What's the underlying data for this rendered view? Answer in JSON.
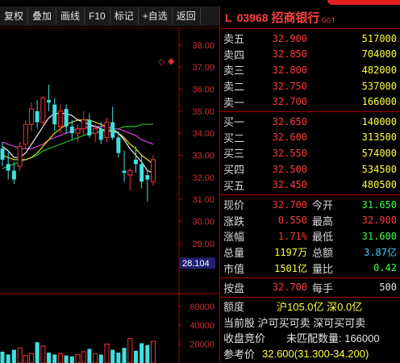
{
  "toolbar": {
    "buttons": [
      "复权",
      "叠加",
      "画线",
      "F10",
      "标记",
      "+自选",
      "返回"
    ]
  },
  "chart": {
    "price_ticks": [
      "38.00",
      "37.00",
      "36.00",
      "35.00",
      "34.00",
      "33.00",
      "32.00",
      "31.00",
      "30.00",
      "29.00",
      "28.00"
    ],
    "current_price_label": "28.104",
    "volume_ticks": [
      "60000",
      "40000",
      "20000"
    ]
  },
  "chart_data": {
    "type": "candlestick",
    "ylim": [
      27.6,
      38.8
    ],
    "candles": [
      {
        "o": 33.3,
        "h": 33.6,
        "l": 32.5,
        "c": 32.8
      },
      {
        "o": 32.6,
        "h": 33.2,
        "l": 31.9,
        "c": 32.3
      },
      {
        "o": 32.3,
        "h": 32.7,
        "l": 31.7,
        "c": 31.9
      },
      {
        "o": 32.5,
        "h": 33.6,
        "l": 32.3,
        "c": 33.4
      },
      {
        "o": 33.5,
        "h": 34.6,
        "l": 33.3,
        "c": 34.4
      },
      {
        "o": 34.4,
        "h": 35.4,
        "l": 34.1,
        "c": 35.1
      },
      {
        "o": 35.0,
        "h": 35.5,
        "l": 34.2,
        "c": 34.5
      },
      {
        "o": 34.5,
        "h": 35.7,
        "l": 34.3,
        "c": 35.6
      },
      {
        "o": 35.5,
        "h": 36.2,
        "l": 35.0,
        "c": 35.4
      },
      {
        "o": 35.3,
        "h": 35.6,
        "l": 34.1,
        "c": 34.4
      },
      {
        "o": 34.3,
        "h": 35.3,
        "l": 34.0,
        "c": 35.0
      },
      {
        "o": 35.1,
        "h": 35.3,
        "l": 34.0,
        "c": 34.3
      },
      {
        "o": 34.3,
        "h": 34.6,
        "l": 33.7,
        "c": 34.0
      },
      {
        "o": 34.0,
        "h": 34.4,
        "l": 33.6,
        "c": 34.2
      },
      {
        "o": 34.2,
        "h": 35.0,
        "l": 33.9,
        "c": 34.6
      },
      {
        "o": 34.6,
        "h": 34.9,
        "l": 33.8,
        "c": 33.9
      },
      {
        "o": 34.0,
        "h": 34.4,
        "l": 33.6,
        "c": 34.2
      },
      {
        "o": 34.2,
        "h": 34.5,
        "l": 33.5,
        "c": 33.7
      },
      {
        "o": 33.8,
        "h": 34.7,
        "l": 33.6,
        "c": 34.5
      },
      {
        "o": 34.5,
        "h": 35.2,
        "l": 33.7,
        "c": 33.8
      },
      {
        "o": 33.8,
        "h": 34.1,
        "l": 32.9,
        "c": 33.1
      },
      {
        "o": 32.3,
        "h": 33.2,
        "l": 31.8,
        "c": 32.2
      },
      {
        "o": 32.1,
        "h": 32.4,
        "l": 31.4,
        "c": 32.3
      },
      {
        "o": 32.8,
        "h": 33.4,
        "l": 32.2,
        "c": 32.6
      },
      {
        "o": 32.6,
        "h": 33.0,
        "l": 31.5,
        "c": 31.8
      },
      {
        "o": 32.1,
        "h": 32.3,
        "l": 30.9,
        "c": 31.9
      },
      {
        "o": 31.8,
        "h": 33.0,
        "l": 31.6,
        "c": 32.8
      }
    ],
    "ma_white": [
      33.4,
      33.2,
      32.9,
      32.9,
      33.1,
      33.5,
      33.9,
      34.3,
      34.7,
      34.9,
      34.9,
      34.9,
      34.8,
      34.6,
      34.5,
      34.4,
      34.3,
      34.2,
      34.1,
      34.1,
      34.0,
      33.7,
      33.3,
      33.0,
      32.7,
      32.3,
      32.2
    ],
    "ma_yellow": [
      33.0,
      32.9,
      32.8,
      32.8,
      32.8,
      32.9,
      33.1,
      33.4,
      33.7,
      34.0,
      34.2,
      34.4,
      34.5,
      34.6,
      34.6,
      34.6,
      34.5,
      34.4,
      34.3,
      34.2,
      34.0,
      33.8,
      33.5,
      33.3,
      33.0,
      32.8,
      32.6
    ],
    "ma_magenta": [
      33.6,
      33.5,
      33.4,
      33.3,
      33.3,
      33.3,
      33.4,
      33.5,
      33.7,
      33.8,
      33.9,
      34.0,
      34.1,
      34.2,
      34.2,
      34.3,
      34.3,
      34.3,
      34.3,
      34.2,
      34.2,
      34.1,
      34.0,
      33.9,
      33.7,
      33.6,
      33.5
    ],
    "ma_green": [
      32.4,
      32.5,
      32.6,
      32.7,
      32.8,
      32.9,
      33.0,
      33.2,
      33.3,
      33.4,
      33.5,
      33.6,
      33.7,
      33.8,
      33.9,
      34.0,
      34.0,
      34.1,
      34.1,
      34.2,
      34.2,
      34.3,
      34.3,
      34.3,
      34.4,
      34.4,
      34.4
    ],
    "volume_ylim": [
      0,
      65000
    ],
    "volumes": [
      12000,
      9000,
      14000,
      16000,
      8000,
      10000,
      22000,
      18000,
      11000,
      9000,
      10000,
      8000,
      7000,
      9000,
      12000,
      15000,
      10000,
      9000,
      20000,
      14000,
      11000,
      16000,
      26000,
      13000,
      21000,
      19000,
      23000
    ]
  },
  "quote": {
    "letter": "L",
    "code": "03968",
    "name": "招商银行",
    "tag": "GGT",
    "asks": [
      {
        "label": "卖五",
        "price": "32.900",
        "vol": "517000"
      },
      {
        "label": "卖四",
        "price": "32.850",
        "vol": "704000"
      },
      {
        "label": "卖三",
        "price": "32.800",
        "vol": "482000"
      },
      {
        "label": "卖二",
        "price": "32.750",
        "vol": "537000"
      },
      {
        "label": "卖一",
        "price": "32.700",
        "vol": "166000"
      }
    ],
    "bids": [
      {
        "label": "买一",
        "price": "32.650",
        "vol": "140000"
      },
      {
        "label": "买二",
        "price": "32.600",
        "vol": "313500"
      },
      {
        "label": "买三",
        "price": "32.550",
        "vol": "574000"
      },
      {
        "label": "买四",
        "price": "32.500",
        "vol": "534500"
      },
      {
        "label": "买五",
        "price": "32.450",
        "vol": "480500"
      }
    ],
    "stats": [
      {
        "l1": "现价",
        "v1": "32.700",
        "c1": "red",
        "l2": "今开",
        "v2": "31.650",
        "c2": "grn"
      },
      {
        "l1": "涨跌",
        "v1": "0.550",
        "c1": "red",
        "l2": "最高",
        "v2": "32.900",
        "c2": "red"
      },
      {
        "l1": "涨幅",
        "v1": "1.71%",
        "c1": "red",
        "l2": "最低",
        "v2": "31.600",
        "c2": "grn"
      },
      {
        "l1": "总量",
        "v1": "1197万",
        "c1": "yel",
        "l2": "总额",
        "v2": "3.87亿",
        "c2": "cyan"
      },
      {
        "l1": "市值",
        "v1": "1501亿",
        "c1": "yel",
        "l2": "量比",
        "v2": "0.42",
        "c2": "grn"
      }
    ],
    "pan": {
      "l1": "按盘",
      "v1": "32.700",
      "l2": "每手",
      "v2": "500"
    },
    "extra": {
      "quota_label": "额度",
      "quota_value": "沪105.0亿 深0.0亿",
      "line2": "当前股  沪可买可卖 深可买可卖",
      "auction_label": "收盘竞价",
      "auction_value": "未匹配数量: 166000",
      "ref_label": "参考价",
      "ref_value": "32.600(31.300-34.200)"
    }
  }
}
